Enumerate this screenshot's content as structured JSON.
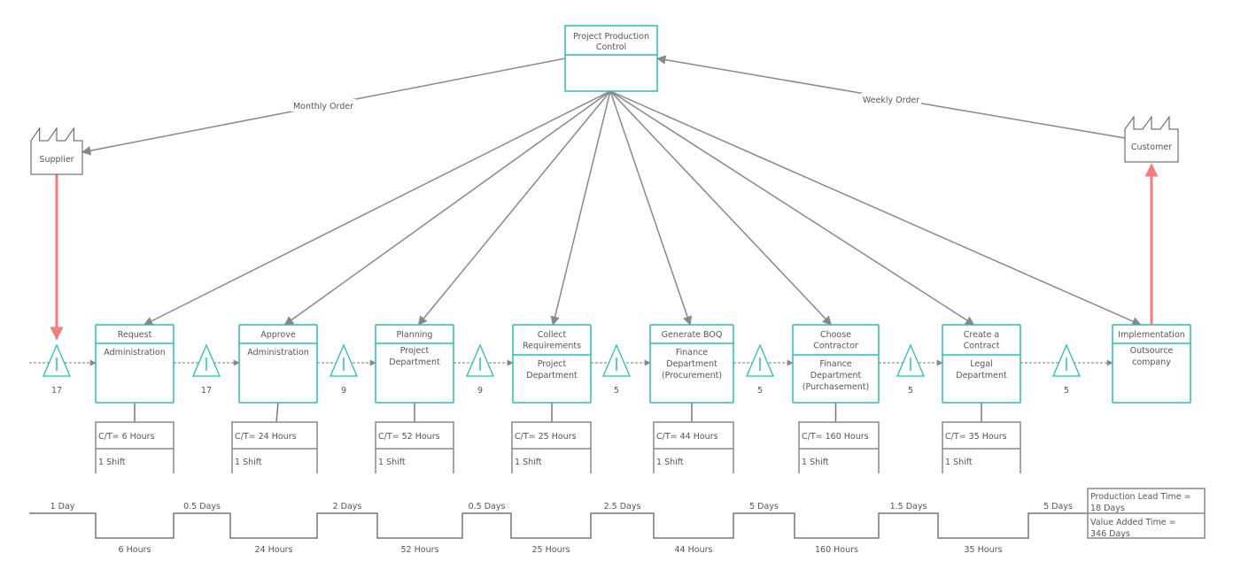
{
  "colors": {
    "process": "#26bfb5",
    "line": "#888888",
    "push": "#f47c7c"
  },
  "control": {
    "title_lines": [
      "Project Production",
      "Control"
    ]
  },
  "supplier": {
    "label": "Supplier",
    "icon": "factory-icon"
  },
  "customer": {
    "label": "Customer",
    "icon": "factory-icon"
  },
  "monthly_order": "Monthly Order",
  "weekly_order": "Weekly Order",
  "processes": [
    {
      "title": [
        "Request"
      ],
      "dept": [
        "Administration"
      ]
    },
    {
      "title": [
        "Approve"
      ],
      "dept": [
        "Administration"
      ]
    },
    {
      "title": [
        "Planning"
      ],
      "dept": [
        "Project",
        "Department"
      ]
    },
    {
      "title": [
        "Collect",
        "Requirements"
      ],
      "dept": [
        "Project",
        "Department"
      ]
    },
    {
      "title": [
        "Generate BOQ"
      ],
      "dept": [
        "Finance",
        "Department",
        "(Procurement)"
      ]
    },
    {
      "title": [
        "Choose",
        "Contractor"
      ],
      "dept": [
        "Finance",
        "Department",
        "(Purchasement)"
      ]
    },
    {
      "title": [
        "Create a",
        "Contract"
      ],
      "dept": [
        "Legal",
        "Department"
      ]
    },
    {
      "title": [
        "Implementation"
      ],
      "dept": [
        "Outsource",
        "company"
      ]
    }
  ],
  "data_boxes": [
    {
      "ct": "C/T= 6 Hours",
      "shift": "1 Shift"
    },
    {
      "ct": "C/T= 24 Hours",
      "shift": "1 Shift"
    },
    {
      "ct": "C/T= 52 Hours",
      "shift": "1 Shift"
    },
    {
      "ct": "C/T= 25 Hours",
      "shift": "1 Shift"
    },
    {
      "ct": "C/T= 44 Hours",
      "shift": "1 Shift"
    },
    {
      "ct": "C/T= 160 Hours",
      "shift": "1 Shift"
    },
    {
      "ct": "C/T= 35 Hours",
      "shift": "1 Shift"
    }
  ],
  "inventory": [
    "17",
    "17",
    "9",
    "9",
    "5",
    "5",
    "5",
    "5"
  ],
  "timeline": {
    "wait": [
      "1 Day",
      "0.5 Days",
      "2 Days",
      "0.5 Days",
      "2.5 Days",
      "5 Days",
      "1.5 Days",
      "5 Days"
    ],
    "process": [
      "6 Hours",
      "24 Hours",
      "52 Hours",
      "25 Hours",
      "44 Hours",
      "160 Hours",
      "35 Hours"
    ]
  },
  "summary": {
    "lead_time": [
      "Production Lead Time =",
      "18 Days"
    ],
    "value_added": [
      "Value Added Time =",
      "346 Days"
    ]
  }
}
